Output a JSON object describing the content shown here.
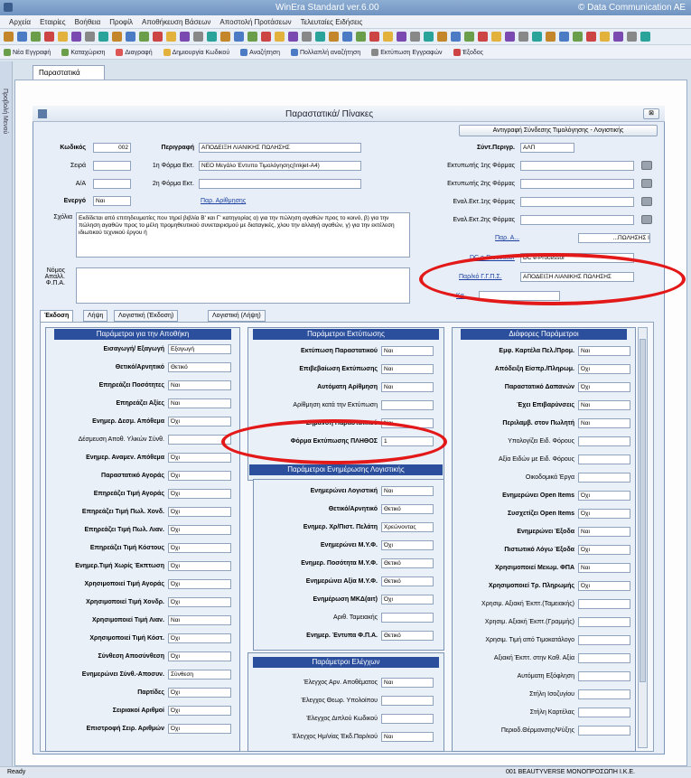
{
  "app": {
    "title": "WinEra Standard ver.6.00",
    "company": "© Data Communication AE"
  },
  "menu": [
    "Αρχεία",
    "Εταιρίες",
    "Βοήθεια",
    "Προφίλ",
    "Αποθήκευση Βάσεων",
    "Αποστολή Προτάσεων",
    "Τελευταίες Ειδήσεις"
  ],
  "toolbar2": [
    "Νέα Εγγραφή",
    "Καταχώριση",
    "Διαγραφή",
    "Δημιουργία Κωδικού",
    "Αναζήτηση",
    "Πολλαπλή αναζήτηση",
    "Εκτύπωση Εγγραφών",
    "Έξοδος"
  ],
  "leftstrip": "Προβολή Μενού",
  "doc_tab": "Παραστατικά",
  "window": {
    "title": "Παραστατικά/ Πίνακες",
    "copy_button": "Αντιγραφή Σύνδεσης Τιμολόγησης - Λογιστικής"
  },
  "header": {
    "code_label": "Κωδικός",
    "code_value": "002",
    "desc_label": "Περιγραφή",
    "desc_value": "ΑΠΟΔΕΙΞΗ ΛΙΑΝΙΚΗΣ ΠΩΛΗΣΗΣ",
    "series_label": "Σειρά",
    "series_value": "",
    "aa_label": "Α/Α",
    "aa_value": "",
    "active_label": "Ενεργό",
    "active_value": "Ναι",
    "form1_label": "1η Φόρμα Εκτ.",
    "form1_value": "ΝΕΟ Μεγάλο Έντυπο Τιμολόγησης(Inkjet-A4)",
    "form2_label": "2η Φόρμα Εκτ.",
    "form2_value": "",
    "num_link": "Παρ. Αρίθμησης",
    "abbr_label": "Σύντ.Περιγρ.",
    "abbr_value": "ΑΛΠ",
    "printer1_label": "Εκτυπωτής 1ης Φόρμας",
    "printer2_label": "Εκτυπωτής 2ης Φόρμας",
    "ext1_label": "Εναλ.Εκτ.1ης Φόρμας",
    "ext2_label": "Εναλ.Εκτ.2ης Φόρμας",
    "paran_link": "Παρ. Α...",
    "paran_value": "...ΠΩΛΗΣΗΣ Ι",
    "dc_link": "DC e-Processor",
    "dc_value": "DC e-Processor",
    "ggps_link": "Παρ/κό Γ.Γ.Π.Σ.",
    "ggps_value": "ΑΠΟΔΕΙΞΗ ΛΙΑΝΙΚΗΣ ΠΩΛΗΣΗΣ",
    "norm_link": "Κα...",
    "comments_label": "Σχόλια",
    "comments_value": "Εκδίδεται από επιτηδευματίες που τηρεί βιβλία Β' και Γ' κατηγορίας α) για την πώληση αγαθών προς το κοινό, β) για την πώληση αγαθών προς το μέλη προμηθευτικού συνεταιρισμού με διαταγικές, χλου την αλλαγή αγαθών, γ) για την εκτέλεση ιδιωτικού τεχνικού έργου ή",
    "law_label": "Νόμος Απαλλ. Φ.Π.Α."
  },
  "subtabs": [
    "Έκδοση",
    "Λήψη",
    "Λογιστική (Έκδοση)",
    "Λογιστική (Λήψη)"
  ],
  "sections": {
    "warehouse": {
      "title": "Παράμετροι για την Αποθήκη",
      "rows": [
        [
          "Εισαγωγή/ Εξαγωγή",
          "Εξαγωγή"
        ],
        [
          "Θετικό/Αρνητικό",
          "Θετικό"
        ],
        [
          "Επηρεάζει Ποσότητες",
          "Ναι"
        ],
        [
          "Επηρεάζει Αξίες",
          "Ναι"
        ],
        [
          "Ενημερ. Δεσμ. Απόθεμα",
          "Όχι"
        ],
        [
          "Δέσμευση Αποθ. Υλικών Σύνθ.",
          ""
        ],
        [
          "Ενημερ. Αναμεν. Απόθεμα",
          "Όχι"
        ],
        [
          "Παραστατικό Αγοράς",
          "Όχι"
        ],
        [
          "Επηρεάζει Τιμή Αγοράς",
          "Όχι"
        ],
        [
          "Επηρεάζει Τιμή Πωλ. Χονδ.",
          "Όχι"
        ],
        [
          "Επηρεάζει Τιμή Πωλ. Λιαν.",
          "Όχι"
        ],
        [
          "Επηρεάζει Τιμή Κόστους",
          "Όχι"
        ],
        [
          "Ενημερ.Τιμή Χωρίς Έκπτωση",
          "Όχι"
        ],
        [
          "Χρησιμοποιεί Τιμή Αγοράς",
          "Όχι"
        ],
        [
          "Χρησιμοποιεί Τιμή Χονδρ.",
          "Όχι"
        ],
        [
          "Χρησιμοποιεί Τιμή Λιαν.",
          "Ναι"
        ],
        [
          "Χρησιμοποιεί Τιμή Κόστ.",
          "Όχι"
        ],
        [
          "Σύνθεση Αποσύνθεση",
          "Όχι"
        ],
        [
          "Ενημερώνει Σύνθ.-Αποσυν.",
          "Σύνθεση"
        ],
        [
          "Παρτίδες",
          "Όχι"
        ],
        [
          "Σειριακοί Αριθμοί",
          "Όχι"
        ],
        [
          "Επιστροφή Σειρ. Αριθμών",
          "Όχι"
        ]
      ]
    },
    "printing": {
      "title": "Παράμετροι Εκτύπωσης",
      "rows": [
        [
          "Εκτύπωση Παραστατικού",
          "Ναι"
        ],
        [
          "Επιβεβαίωση Εκτύπωσης",
          "Ναι"
        ],
        [
          "Αυτόματη Αρίθμηση",
          "Ναι"
        ],
        [
          "Αρίθμηση κατά την Εκτύπωση",
          ""
        ],
        [
          "Σήμανση Παραστατικού",
          "Ναι"
        ],
        [
          "Φόρμα Εκτύπωσης ΠΛΗΘΟΣ",
          "1"
        ]
      ]
    },
    "accounting": {
      "title": "Παράμετροι Ενημέρωσης Λογιστικής",
      "rows": [
        [
          "Ενημερώνει Λογιστική",
          "Ναι"
        ],
        [
          "Θετικό/Αρνητικό",
          "Θετικό"
        ],
        [
          "Ενημερ. Χρ/Πιστ. Πελάτη",
          "Χρεώνοντας"
        ],
        [
          "Ενημερώνει Μ.Υ.Φ.",
          "Όχι"
        ],
        [
          "Ενημερ. Ποσότητα Μ.Υ.Φ.",
          "Θετικό"
        ],
        [
          "Ενημερώνει Αξία Μ.Υ.Φ.",
          "Θετικό"
        ],
        [
          "Ενημέρωση ΜΚΔ(αιτ)",
          "Όχι"
        ],
        [
          "Αριθ. Ταμειακής",
          ""
        ],
        [
          "Ενημερ. Έντυπα Φ.Π.Α.",
          "Θετικό"
        ]
      ]
    },
    "checks": {
      "title": "Παράμετροι Ελέγχων",
      "rows": [
        [
          "Έλεγχος Αρν. Αποθέματος",
          "Ναι"
        ],
        [
          "Έλεγχος Θεωρ. Υπολοίπου",
          ""
        ],
        [
          "Έλεγχος Διπλού Κωδικού",
          ""
        ],
        [
          "Έλεγχος Ημ/νίας Έκδ.Παρ/κού",
          "Ναι"
        ]
      ]
    },
    "other": {
      "title": "Διάφορες Παράμετροι",
      "rows": [
        [
          "Εμφ. Καρτέλα Πελ./Προμ.",
          "Ναι"
        ],
        [
          "Απόδειξη Είσπρ./Πληρωμ.",
          "Όχι"
        ],
        [
          "Παραστατικό Δαπανών",
          "Όχι"
        ],
        [
          "Έχει Επιβαρύνσεις",
          "Ναι"
        ],
        [
          "Περιλαμβ. στον Πωλητή",
          "Ναι"
        ],
        [
          "Υπολογίζει Ειδ. Φόρους",
          ""
        ],
        [
          "Αξία Ειδών με Ειδ. Φόρους",
          ""
        ],
        [
          "Οικοδομικά Έργα",
          ""
        ],
        [
          "Ενημερώνει Open Items",
          "Όχι"
        ],
        [
          "Συσχετίζει Open Items",
          "Όχι"
        ],
        [
          "Ενημερώνει Έξοδα",
          "Ναι"
        ],
        [
          "Πιστωτικό Λόγω Έξοδα",
          "Όχι"
        ],
        [
          "Χρησιμοποιεί Μειωμ. ΦΠΑ",
          "Ναι"
        ],
        [
          "Χρησιμοποιεί Τρ. Πληρωμής",
          "Όχι"
        ],
        [
          "Χρησιμ. Αξιακή Έκπτ.(Ταμειακής)",
          ""
        ],
        [
          "Χρησιμ. Αξιακή Έκπτ.(Γραμμής)",
          ""
        ],
        [
          "Χρησιμ. Τιμή από Τιμοκατάλογο",
          ""
        ],
        [
          "Αξιακή Έκπτ. στην Καθ. Αξία",
          ""
        ],
        [
          "Αυτόματη Εξόφληση",
          ""
        ],
        [
          "Στήλη Ισοζυγίου",
          ""
        ],
        [
          "Στήλη Καρτέλας",
          ""
        ],
        [
          "Περιοδ.Θέρμανσης/Ψύξης",
          ""
        ]
      ]
    }
  },
  "status": {
    "left": "Ready",
    "right": "001 BEAUTYVERSE ΜΟΝΟΠΡΟΣΩΠΗ Ι.Κ.Ε."
  }
}
